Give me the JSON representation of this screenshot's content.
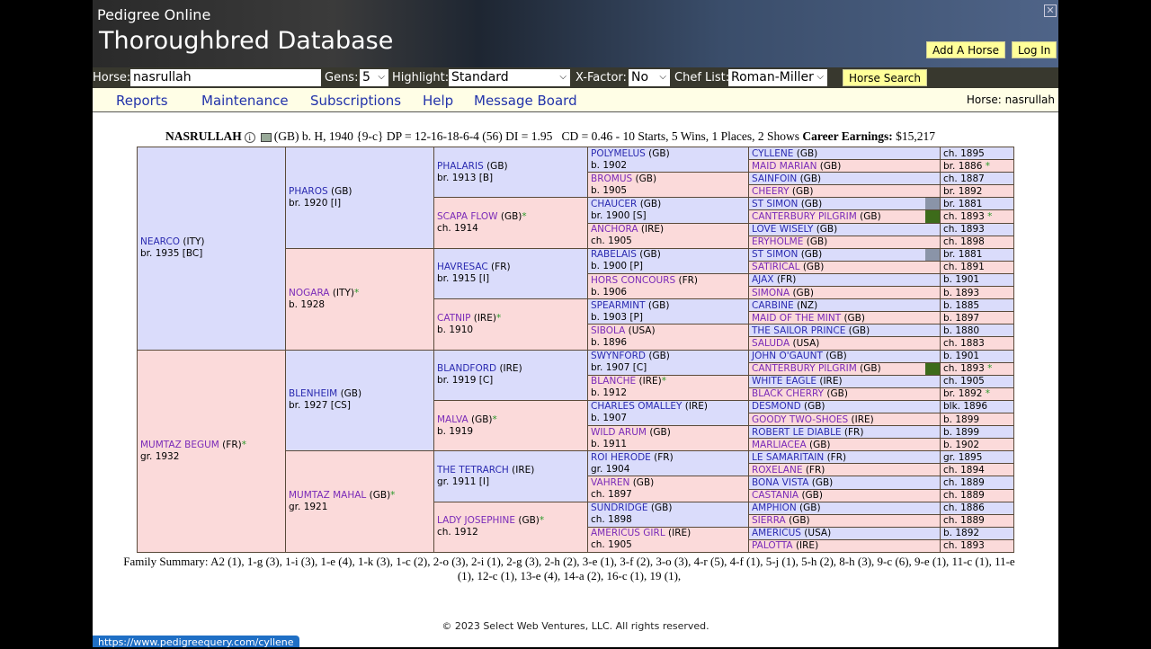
{
  "header": {
    "subtitle": "Pedigree Online",
    "title": "Thoroughbred Database",
    "add_horse": "Add A Horse",
    "log_in": "Log In"
  },
  "search": {
    "horse_label": "Horse:",
    "horse_value": "nasrullah",
    "gens_label": "Gens:",
    "gens_value": "5",
    "highlight_label": "Highlight:",
    "highlight_value": "Standard",
    "xfactor_label": "X-Factor:",
    "xfactor_value": "No",
    "chef_label": "Chef List:",
    "chef_value": "Roman-Miller",
    "search_button": "Horse Search"
  },
  "nav": {
    "items": [
      "Reports",
      "Maintenance",
      "Subscriptions",
      "Help",
      "Message Board"
    ],
    "current_horse": "Horse: nasrullah"
  },
  "info": {
    "name": "NASRULLAH",
    "details": "(GB) b. H, 1940 {9-c} DP = 12-16-18-6-4 (56) DI = 1.95   CD = 0.46 - 10 Starts, 5 Wins, 1 Places, 2 Shows",
    "earnings_label": "Career Earnings:",
    "earnings_value": "$15,217"
  },
  "colors": {
    "sire_bg": "#dadcfb",
    "dam_bg": "#fbdada",
    "gray_mark": "#8a94a8",
    "green_mark": "#3d6b1a"
  },
  "pedigree": {
    "gen1": [
      {
        "name": "NEARCO",
        "country": "(ITY)",
        "info": "br. 1935 [BC]",
        "star": false
      },
      {
        "name": "MUMTAZ BEGUM",
        "country": "(FR)",
        "info": "gr. 1932",
        "star": true
      }
    ],
    "gen2": [
      {
        "name": "PHAROS",
        "country": "(GB)",
        "info": "br. 1920 [I]",
        "star": false
      },
      {
        "name": "NOGARA",
        "country": "(ITY)",
        "info": "b. 1928",
        "star": true
      },
      {
        "name": "BLENHEIM",
        "country": "(GB)",
        "info": "br. 1927 [CS]",
        "star": false
      },
      {
        "name": "MUMTAZ MAHAL",
        "country": "(GB)",
        "info": "gr. 1921",
        "star": true
      }
    ],
    "gen3": [
      {
        "name": "PHALARIS",
        "country": "(GB)",
        "info": "br. 1913 [B]",
        "star": false
      },
      {
        "name": "SCAPA FLOW",
        "country": "(GB)",
        "info": "ch. 1914",
        "star": true
      },
      {
        "name": "HAVRESAC",
        "country": "(FR)",
        "info": "br. 1915 [I]",
        "star": false
      },
      {
        "name": "CATNIP",
        "country": "(IRE)",
        "info": "b. 1910",
        "star": true
      },
      {
        "name": "BLANDFORD",
        "country": "(IRE)",
        "info": "br. 1919 [C]",
        "star": false
      },
      {
        "name": "MALVA",
        "country": "(GB)",
        "info": "b. 1919",
        "star": true
      },
      {
        "name": "THE TETRARCH",
        "country": "(IRE)",
        "info": "gr. 1911 [I]",
        "star": false
      },
      {
        "name": "LADY JOSEPHINE",
        "country": "(GB)",
        "info": "ch. 1912",
        "star": true
      }
    ],
    "gen4": [
      {
        "name": "POLYMELUS",
        "country": "(GB)",
        "info": "b. 1902",
        "star": false
      },
      {
        "name": "BROMUS",
        "country": "(GB)",
        "info": "b. 1905",
        "star": false
      },
      {
        "name": "CHAUCER",
        "country": "(GB)",
        "info": "br. 1900 [S]",
        "star": false
      },
      {
        "name": "ANCHORA",
        "country": "(IRE)",
        "info": "ch. 1905",
        "star": false
      },
      {
        "name": "RABELAIS",
        "country": "(GB)",
        "info": "b. 1900 [P]",
        "star": false
      },
      {
        "name": "HORS CONCOURS",
        "country": "(FR)",
        "info": "b. 1906",
        "star": false
      },
      {
        "name": "SPEARMINT",
        "country": "(GB)",
        "info": "b. 1903 [P]",
        "star": false
      },
      {
        "name": "SIBOLA",
        "country": "(USA)",
        "info": "b. 1896",
        "star": false
      },
      {
        "name": "SWYNFORD",
        "country": "(GB)",
        "info": "br. 1907 [C]",
        "star": false
      },
      {
        "name": "BLANCHE",
        "country": "(IRE)",
        "info": "b. 1912",
        "star": true
      },
      {
        "name": "CHARLES OMALLEY",
        "country": "(IRE)",
        "info": "b. 1907",
        "star": false
      },
      {
        "name": "WILD ARUM",
        "country": "(GB)",
        "info": "b. 1911",
        "star": false
      },
      {
        "name": "ROI HERODE",
        "country": "(FR)",
        "info": "gr. 1904",
        "star": false
      },
      {
        "name": "VAHREN",
        "country": "(GB)",
        "info": "ch. 1897",
        "star": false
      },
      {
        "name": "SUNDRIDGE",
        "country": "(GB)",
        "info": "ch. 1898",
        "star": false
      },
      {
        "name": "AMERICUS GIRL",
        "country": "(IRE)",
        "info": "ch. 1905",
        "star": false
      }
    ],
    "gen5": [
      {
        "name": "CYLLENE",
        "country": "(GB)",
        "info": "ch. 1895",
        "star": false,
        "mark": ""
      },
      {
        "name": "MAID MARIAN",
        "country": "(GB)",
        "info": "br. 1886",
        "star": true,
        "mark": ""
      },
      {
        "name": "SAINFOIN",
        "country": "(GB)",
        "info": "ch. 1887",
        "star": false,
        "mark": ""
      },
      {
        "name": "CHEERY",
        "country": "(GB)",
        "info": "br. 1892",
        "star": false,
        "mark": ""
      },
      {
        "name": "ST SIMON",
        "country": "(GB)",
        "info": "br. 1881",
        "star": false,
        "mark": "gray"
      },
      {
        "name": "CANTERBURY PILGRIM",
        "country": "(GB)",
        "info": "ch. 1893",
        "star": true,
        "mark": "green"
      },
      {
        "name": "LOVE WISELY",
        "country": "(GB)",
        "info": "ch. 1893",
        "star": false,
        "mark": ""
      },
      {
        "name": "ERYHOLME",
        "country": "(GB)",
        "info": "ch. 1898",
        "star": false,
        "mark": ""
      },
      {
        "name": "ST SIMON",
        "country": "(GB)",
        "info": "br. 1881",
        "star": false,
        "mark": "gray"
      },
      {
        "name": "SATIRICAL",
        "country": "(GB)",
        "info": "ch. 1891",
        "star": false,
        "mark": ""
      },
      {
        "name": "AJAX",
        "country": "(FR)",
        "info": "b. 1901",
        "star": false,
        "mark": ""
      },
      {
        "name": "SIMONA",
        "country": "(GB)",
        "info": "b. 1893",
        "star": false,
        "mark": ""
      },
      {
        "name": "CARBINE",
        "country": "(NZ)",
        "info": "b. 1885",
        "star": false,
        "mark": ""
      },
      {
        "name": "MAID OF THE MINT",
        "country": "(GB)",
        "info": "b. 1897",
        "star": false,
        "mark": ""
      },
      {
        "name": "THE SAILOR PRINCE",
        "country": "(GB)",
        "info": "b. 1880",
        "star": false,
        "mark": ""
      },
      {
        "name": "SALUDA",
        "country": "(USA)",
        "info": "ch. 1883",
        "star": false,
        "mark": ""
      },
      {
        "name": "JOHN O'GAUNT",
        "country": "(GB)",
        "info": "b. 1901",
        "star": false,
        "mark": ""
      },
      {
        "name": "CANTERBURY PILGRIM",
        "country": "(GB)",
        "info": "ch. 1893",
        "star": true,
        "mark": "green"
      },
      {
        "name": "WHITE EAGLE",
        "country": "(IRE)",
        "info": "ch. 1905",
        "star": false,
        "mark": ""
      },
      {
        "name": "BLACK CHERRY",
        "country": "(GB)",
        "info": "br. 1892",
        "star": true,
        "mark": ""
      },
      {
        "name": "DESMOND",
        "country": "(GB)",
        "info": "blk. 1896",
        "star": false,
        "mark": ""
      },
      {
        "name": "GOODY TWO-SHOES",
        "country": "(IRE)",
        "info": "b. 1899",
        "star": false,
        "mark": ""
      },
      {
        "name": "ROBERT LE DIABLE",
        "country": "(FR)",
        "info": "b. 1899",
        "star": false,
        "mark": ""
      },
      {
        "name": "MARLIACEA",
        "country": "(GB)",
        "info": "b. 1902",
        "star": false,
        "mark": ""
      },
      {
        "name": "LE SAMARITAIN",
        "country": "(FR)",
        "info": "gr. 1895",
        "star": false,
        "mark": ""
      },
      {
        "name": "ROXELANE",
        "country": "(FR)",
        "info": "ch. 1894",
        "star": false,
        "mark": ""
      },
      {
        "name": "BONA VISTA",
        "country": "(GB)",
        "info": "ch. 1889",
        "star": false,
        "mark": ""
      },
      {
        "name": "CASTANIA",
        "country": "(GB)",
        "info": "ch. 1889",
        "star": false,
        "mark": ""
      },
      {
        "name": "AMPHION",
        "country": "(GB)",
        "info": "ch. 1886",
        "star": false,
        "mark": ""
      },
      {
        "name": "SIERRA",
        "country": "(GB)",
        "info": "ch. 1889",
        "star": false,
        "mark": ""
      },
      {
        "name": "AMERICUS",
        "country": "(USA)",
        "info": "b. 1892",
        "star": false,
        "mark": ""
      },
      {
        "name": "PALOTTA",
        "country": "(IRE)",
        "info": "ch. 1893",
        "star": false,
        "mark": ""
      }
    ]
  },
  "star_symbol": "*",
  "family_summary": "Family Summary: A2 (1), 1-g (3), 1-i (3), 1-e (4), 1-k (3), 1-c (2), 2-o (3), 2-i (1), 2-g (3), 2-h (2), 3-e (1), 3-f (2), 3-o (3), 4-r (5), 4-f (1), 5-j (1), 5-h (2), 8-h (3), 9-c (6), 9-e (1), 11-c (1), 11-e (1), 12-c (1), 13-e (4), 14-a (2), 16-c (1), 19 (1),",
  "footer": "© 2023 Select Web Ventures, LLC. All rights reserved.",
  "status_url": "https://www.pedigreequery.com/cyllene"
}
